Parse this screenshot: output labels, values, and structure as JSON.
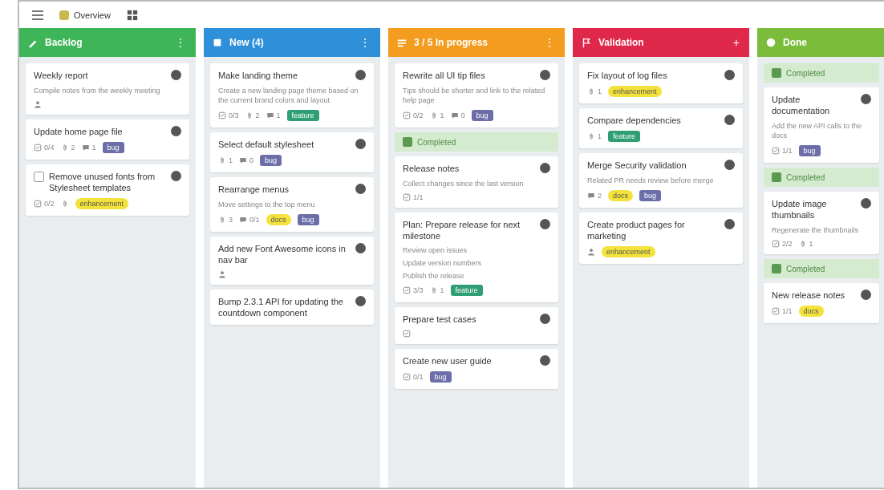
{
  "toolbar": {
    "board_name": "Overview"
  },
  "columns": [
    {
      "title": "Backlog",
      "color": "#3fb55a",
      "action": "⋮",
      "items": [
        {
          "kind": "card",
          "title": "Weekly report",
          "description": "Compile notes from the weekly meeting",
          "meta": [
            {
              "kind": "assignee"
            }
          ]
        },
        {
          "kind": "card",
          "title": "Update home page file",
          "meta": [
            {
              "kind": "checklist",
              "text": "0/4"
            },
            {
              "kind": "attachment",
              "text": "2"
            },
            {
              "kind": "comment",
              "text": "1"
            }
          ],
          "tags": [
            {
              "text": "bug",
              "color": "#6c6ea8"
            }
          ]
        },
        {
          "kind": "card",
          "checked": false,
          "title": "Remove unused fonts from Stylesheet templates",
          "meta": [
            {
              "kind": "checklist",
              "text": "0/2"
            },
            {
              "kind": "attachment"
            }
          ],
          "tags": [
            {
              "text": "enhancement",
              "color": "#f3e23c"
            }
          ]
        }
      ]
    },
    {
      "title": "New (4)",
      "color": "#2e90d8",
      "action": "⋮",
      "items": [
        {
          "kind": "card",
          "title": "Make landing theme",
          "description": "Create a new landing page theme based on the current brand colors and layout",
          "meta": [
            {
              "kind": "checklist",
              "text": "0/3"
            },
            {
              "kind": "attachment",
              "text": "2"
            },
            {
              "kind": "comment",
              "text": "1"
            }
          ],
          "tags": [
            {
              "text": "feature",
              "color": "#2f9e74"
            }
          ]
        },
        {
          "kind": "card",
          "title": "Select default stylesheet",
          "meta": [
            {
              "kind": "attachment",
              "text": "1"
            },
            {
              "kind": "comment",
              "text": "0"
            }
          ],
          "tags": [
            {
              "text": "bug",
              "color": "#6c6ea8"
            }
          ]
        },
        {
          "kind": "card",
          "title": "Rearrange menus",
          "description": "Move settings to the top menu",
          "meta": [
            {
              "kind": "attachment",
              "text": "3"
            },
            {
              "kind": "comment",
              "text": "0/1"
            }
          ],
          "tags": [
            {
              "text": "docs",
              "color": "#f3e23c"
            },
            {
              "text": "bug",
              "color": "#6c6ea8"
            }
          ]
        },
        {
          "kind": "card",
          "title": "Add new Font Awesome icons in nav bar",
          "meta": [
            {
              "kind": "assignee"
            }
          ]
        },
        {
          "kind": "card",
          "title": "Bump 2.3.1 API for updating the countdown component"
        }
      ]
    },
    {
      "title": "3 / 5 In progress",
      "color": "#f39c1f",
      "action": "⋮",
      "items": [
        {
          "kind": "card",
          "title": "Rewrite all UI tip files",
          "description": "Tips should be shorter and link to the related help page",
          "meta": [
            {
              "kind": "checklist",
              "text": "0/2"
            },
            {
              "kind": "attachment",
              "text": "1"
            },
            {
              "kind": "comment",
              "text": "0"
            }
          ],
          "tags": [
            {
              "text": "bug",
              "color": "#6c6ea8"
            }
          ]
        },
        {
          "kind": "group",
          "title": "Completed"
        },
        {
          "kind": "card",
          "title": "Release notes",
          "description": "Collect changes since the last version",
          "meta": [
            {
              "kind": "checklist",
              "text": "1/1"
            }
          ]
        },
        {
          "kind": "card",
          "title": "Plan: Prepare release for next milestone",
          "checklist": [
            "Review open issues",
            "Update version numbers",
            "Publish the release"
          ],
          "meta": [
            {
              "kind": "checklist",
              "text": "3/3"
            },
            {
              "kind": "attachment",
              "text": "1"
            }
          ],
          "tags": [
            {
              "text": "feature",
              "color": "#2f9e74"
            }
          ]
        },
        {
          "kind": "card",
          "title": "Prepare test cases",
          "meta": [
            {
              "kind": "checklist"
            }
          ]
        },
        {
          "kind": "card",
          "title": "Create new user guide",
          "meta": [
            {
              "kind": "checklist",
              "text": "0/1"
            }
          ],
          "tags": [
            {
              "text": "bug",
              "color": "#6c6ea8"
            }
          ]
        }
      ]
    },
    {
      "title": "Validation",
      "color": "#e0284a",
      "action": "+",
      "items": [
        {
          "kind": "card",
          "title": "Fix layout of log files",
          "meta": [
            {
              "kind": "attachment",
              "text": "1"
            }
          ],
          "tags": [
            {
              "text": "enhancement",
              "color": "#f3e23c"
            }
          ]
        },
        {
          "kind": "card",
          "title": "Compare dependencies",
          "meta": [
            {
              "kind": "attachment",
              "text": "1"
            }
          ],
          "tags": [
            {
              "text": "feature",
              "color": "#2f9e74"
            }
          ]
        },
        {
          "kind": "card",
          "title": "Merge Security validation",
          "description": "Related PR needs review before merge",
          "meta": [
            {
              "kind": "comment",
              "text": "2"
            }
          ],
          "tags": [
            {
              "text": "docs",
              "color": "#f3e23c"
            },
            {
              "text": "bug",
              "color": "#6c6ea8"
            }
          ]
        },
        {
          "kind": "card",
          "title": "Create product pages for marketing",
          "meta": [
            {
              "kind": "assignee"
            }
          ],
          "tags": [
            {
              "text": "enhancement",
              "color": "#f3e23c"
            }
          ]
        }
      ]
    },
    {
      "title": "Done",
      "color": "#7bbd3b",
      "items": [
        {
          "kind": "group",
          "title": "Completed"
        },
        {
          "kind": "card",
          "title": "Update documentation",
          "description": "Add the new API calls to the docs",
          "meta": [
            {
              "kind": "checklist",
              "text": "1/1"
            }
          ],
          "tags": [
            {
              "text": "bug",
              "color": "#6c6ea8"
            }
          ]
        },
        {
          "kind": "group",
          "title": "Completed"
        },
        {
          "kind": "card",
          "title": "Update image thumbnails",
          "description": "Regenerate the thumbnails",
          "meta": [
            {
              "kind": "checklist",
              "text": "2/2"
            },
            {
              "kind": "attachment",
              "text": "1"
            }
          ]
        },
        {
          "kind": "group",
          "title": "Completed"
        },
        {
          "kind": "card",
          "title": "New release notes",
          "meta": [
            {
              "kind": "checklist",
              "text": "1/1"
            }
          ],
          "tags": [
            {
              "text": "docs",
              "color": "#f3e23c"
            }
          ]
        }
      ]
    }
  ]
}
